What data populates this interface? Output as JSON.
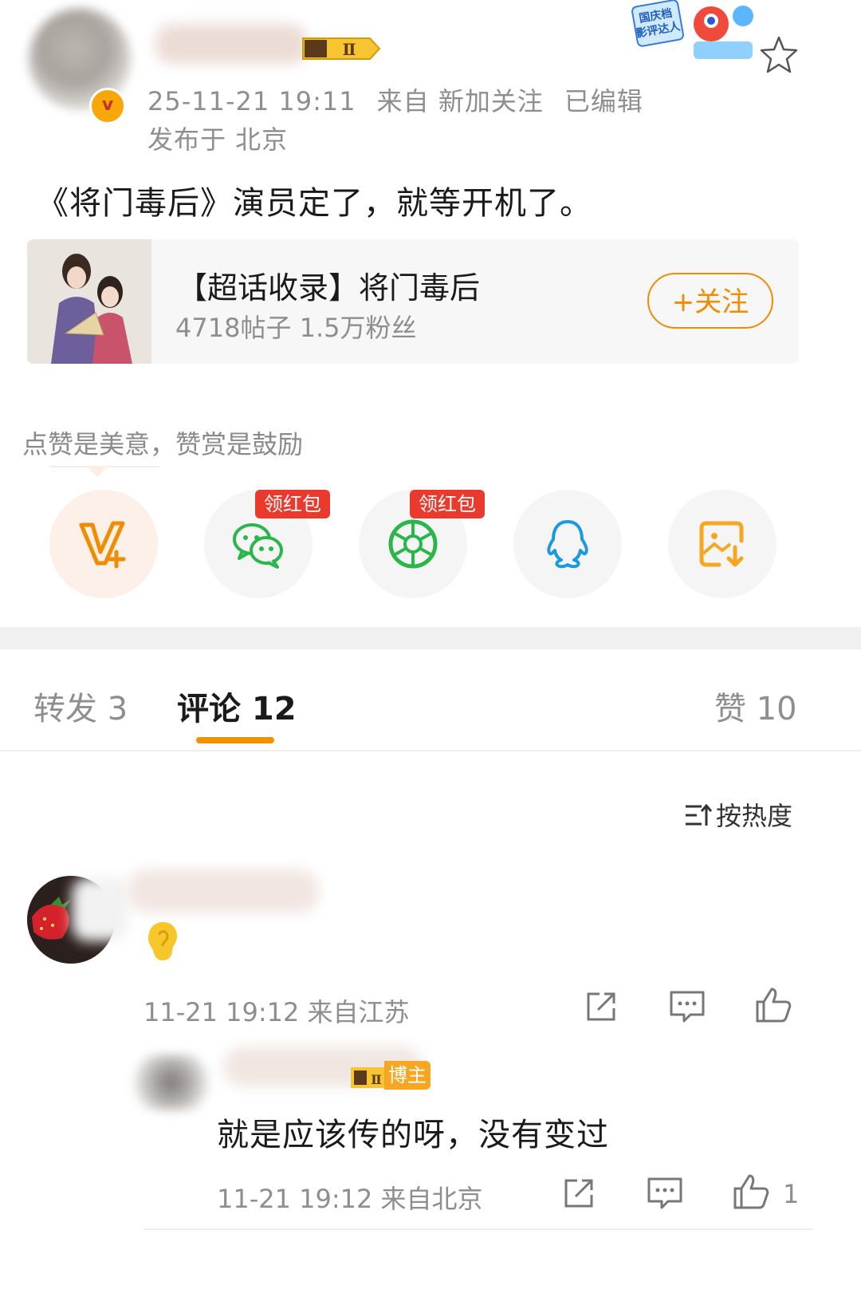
{
  "post": {
    "timestamp": "25-11-21 19:11",
    "source": "来自 新加关注",
    "edited": "已编辑",
    "location": "发布于 北京",
    "text": "《将门毒后》演员定了，就等开机了。",
    "verified_badge": "v",
    "level_badge": "Ⅱ"
  },
  "corner_badge": {
    "line1": "国庆档",
    "line2": "影评达人"
  },
  "topic": {
    "title": "【超话收录】将门毒后",
    "stats": "4718帖子 1.5万粉丝",
    "follow_label": "+关注"
  },
  "reward": {
    "prompt": "点赞是美意，赞赏是鼓励"
  },
  "share": {
    "redpack_label": "领红包",
    "items": [
      "reward",
      "wechat",
      "moments",
      "qq",
      "save-image"
    ]
  },
  "tabs": {
    "repost": "转发 3",
    "comments": "评论 12",
    "likes": "赞 10"
  },
  "sort": {
    "label": "按热度"
  },
  "comment": {
    "meta": "11-21 19:12  来自江苏"
  },
  "reply": {
    "badge": "博主",
    "text": "就是应该传的呀，没有变过",
    "meta": "11-21 19:12  来自北京",
    "like_count": "1"
  },
  "colors": {
    "accent": "#f29100",
    "follow": "#f08c00",
    "redpack": "#ea3a2e",
    "wechat": "#2ab64b",
    "qq": "#1b9ae0",
    "save": "#f5a623"
  }
}
